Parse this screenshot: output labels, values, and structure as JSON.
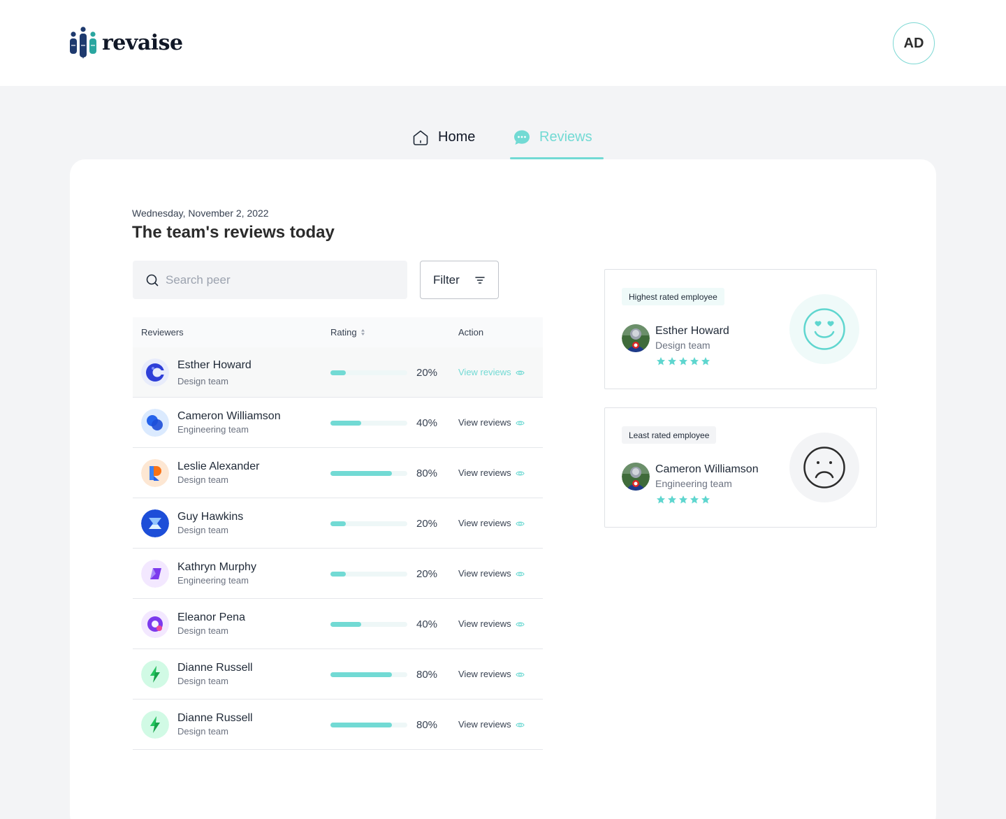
{
  "brand": {
    "name": "revaise"
  },
  "user": {
    "initials": "AD"
  },
  "nav": {
    "home_label": "Home",
    "reviews_label": "Reviews",
    "active": "Reviews"
  },
  "page": {
    "date": "Wednesday, November 2, 2022",
    "title": "The team's reviews today"
  },
  "search": {
    "placeholder": "Search peer"
  },
  "filter": {
    "label": "Filter"
  },
  "table": {
    "headers": {
      "reviewers": "Reviewers",
      "rating": "Rating",
      "action": "Action"
    },
    "rows": [
      {
        "name": "Esther Howard",
        "team": "Design team",
        "rating": 20,
        "rating_label": "20%",
        "action": "View reviews",
        "avatar_icon": "c-logo-icon",
        "selected": true
      },
      {
        "name": "Cameron Williamson",
        "team": "Engineering team",
        "rating": 40,
        "rating_label": "40%",
        "action": "View reviews",
        "avatar_icon": "blue-circles-logo-icon"
      },
      {
        "name": "Leslie Alexander",
        "team": "Design team",
        "rating": 80,
        "rating_label": "80%",
        "action": "View reviews",
        "avatar_icon": "r-logo-icon"
      },
      {
        "name": "Guy Hawkins",
        "team": "Design team",
        "rating": 20,
        "rating_label": "20%",
        "action": "View reviews",
        "avatar_icon": "hourglass-logo-icon"
      },
      {
        "name": "Kathryn Murphy",
        "team": "Engineering team",
        "rating": 20,
        "rating_label": "20%",
        "action": "View reviews",
        "avatar_icon": "purple-leaf-logo-icon"
      },
      {
        "name": "Eleanor Pena",
        "team": "Design team",
        "rating": 40,
        "rating_label": "40%",
        "action": "View reviews",
        "avatar_icon": "q-logo-icon"
      },
      {
        "name": "Dianne Russell",
        "team": "Design team",
        "rating": 80,
        "rating_label": "80%",
        "action": "View reviews",
        "avatar_icon": "green-bolt-logo-icon"
      },
      {
        "name": "Dianne Russell",
        "team": "Design team",
        "rating": 80,
        "rating_label": "80%",
        "action": "View reviews",
        "avatar_icon": "green-bolt-logo-icon"
      }
    ]
  },
  "highlights": {
    "highest": {
      "badge": "Highest rated employee",
      "name": "Esther Howard",
      "team": "Design team",
      "stars": 5,
      "face_icon": "heart-eyes-smile-icon"
    },
    "lowest": {
      "badge": "Least rated employee",
      "name": "Cameron Williamson",
      "team": "Engineering team",
      "stars": 5,
      "face_icon": "sad-face-icon"
    }
  },
  "colors": {
    "accent": "#72dad4",
    "text": "#1f2937",
    "muted": "#6b7280",
    "background": "#f3f4f6"
  }
}
